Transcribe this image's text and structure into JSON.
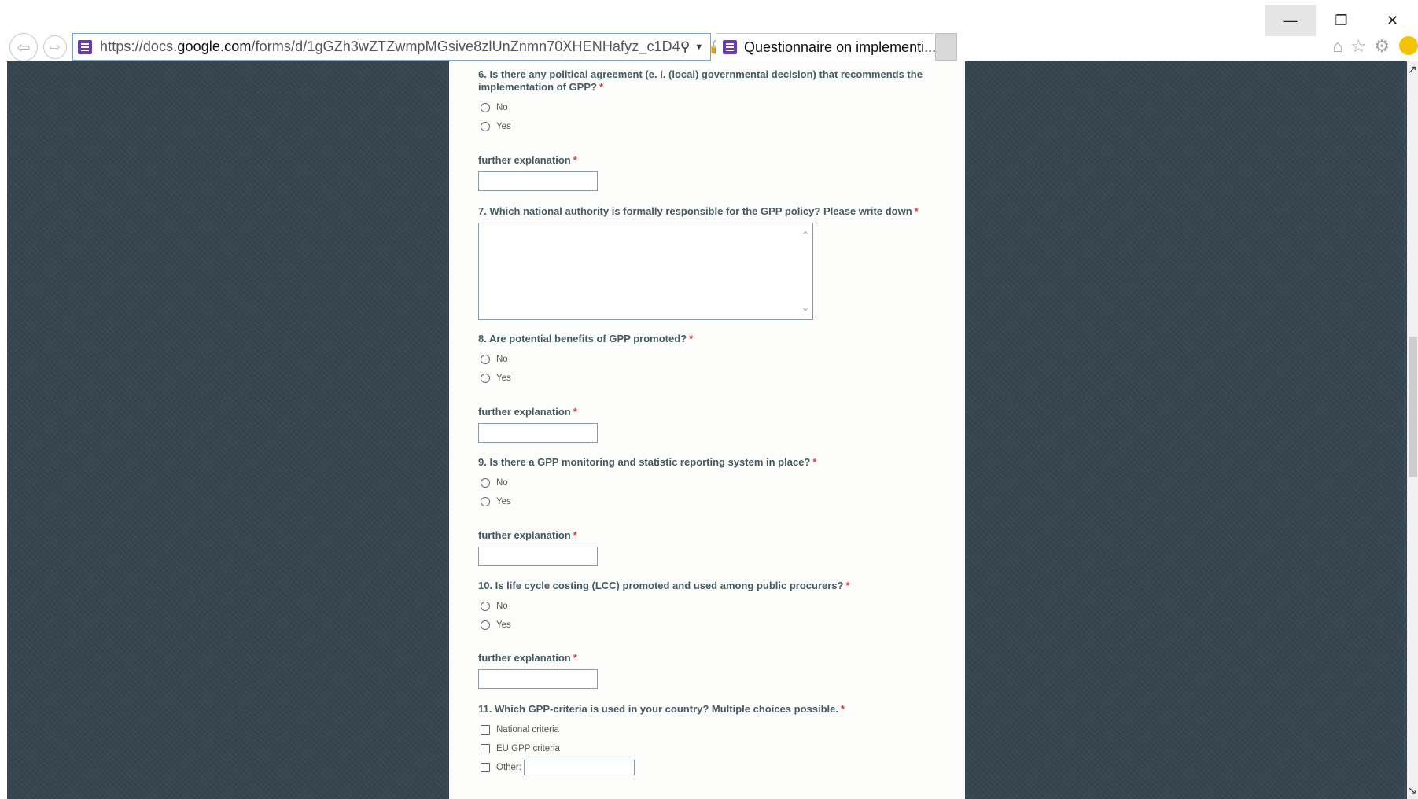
{
  "browser": {
    "url_prefix": "https://docs.",
    "url_domain": "google.com",
    "url_path": "/forms/d/1gGZh3wZTZwmpMGsive8zlUnZnmn70XHENHafyz_c1D4",
    "tab_title": "Questionnaire on implementi...",
    "icons": [
      "back-arrow-icon",
      "forward-arrow-icon",
      "search-icon",
      "lock-icon",
      "refresh-icon",
      "home-icon",
      "star-icon",
      "gear-icon",
      "smiley-icon"
    ]
  },
  "required_marker": "*",
  "options_yes_no": [
    "No",
    "Yes"
  ],
  "questions": {
    "q6": {
      "title": "6. Is there any political agreement (e. i. (local) governmental decision) that recommends the implementation of GPP?",
      "options": [
        "No",
        "Yes"
      ],
      "explanation_label": "further explanation"
    },
    "q7": {
      "title": "7. Which national authority is formally responsible for the GPP policy? Please write down"
    },
    "q8": {
      "title": "8. Are potential benefits of GPP promoted?",
      "options": [
        "No",
        "Yes"
      ],
      "explanation_label": "further explanation"
    },
    "q9": {
      "title": "9. Is there a GPP monitoring and statistic reporting system in place?",
      "options": [
        "No",
        "Yes"
      ],
      "explanation_label": "further explanation"
    },
    "q10": {
      "title": "10. Is life cycle costing (LCC) promoted and used among public procurers?",
      "options": [
        "No",
        "Yes"
      ],
      "explanation_label": "further explanation"
    },
    "q11": {
      "title": "11. Which GPP-criteria is used in your country? Multiple choices possible.",
      "options": [
        "National criteria",
        "EU GPP criteria"
      ],
      "other_label": "Other:"
    }
  },
  "colors": {
    "page_bg": "#36464f",
    "form_bg": "#fcfdfa",
    "title_text": "#455a64",
    "required": "#e53935"
  }
}
